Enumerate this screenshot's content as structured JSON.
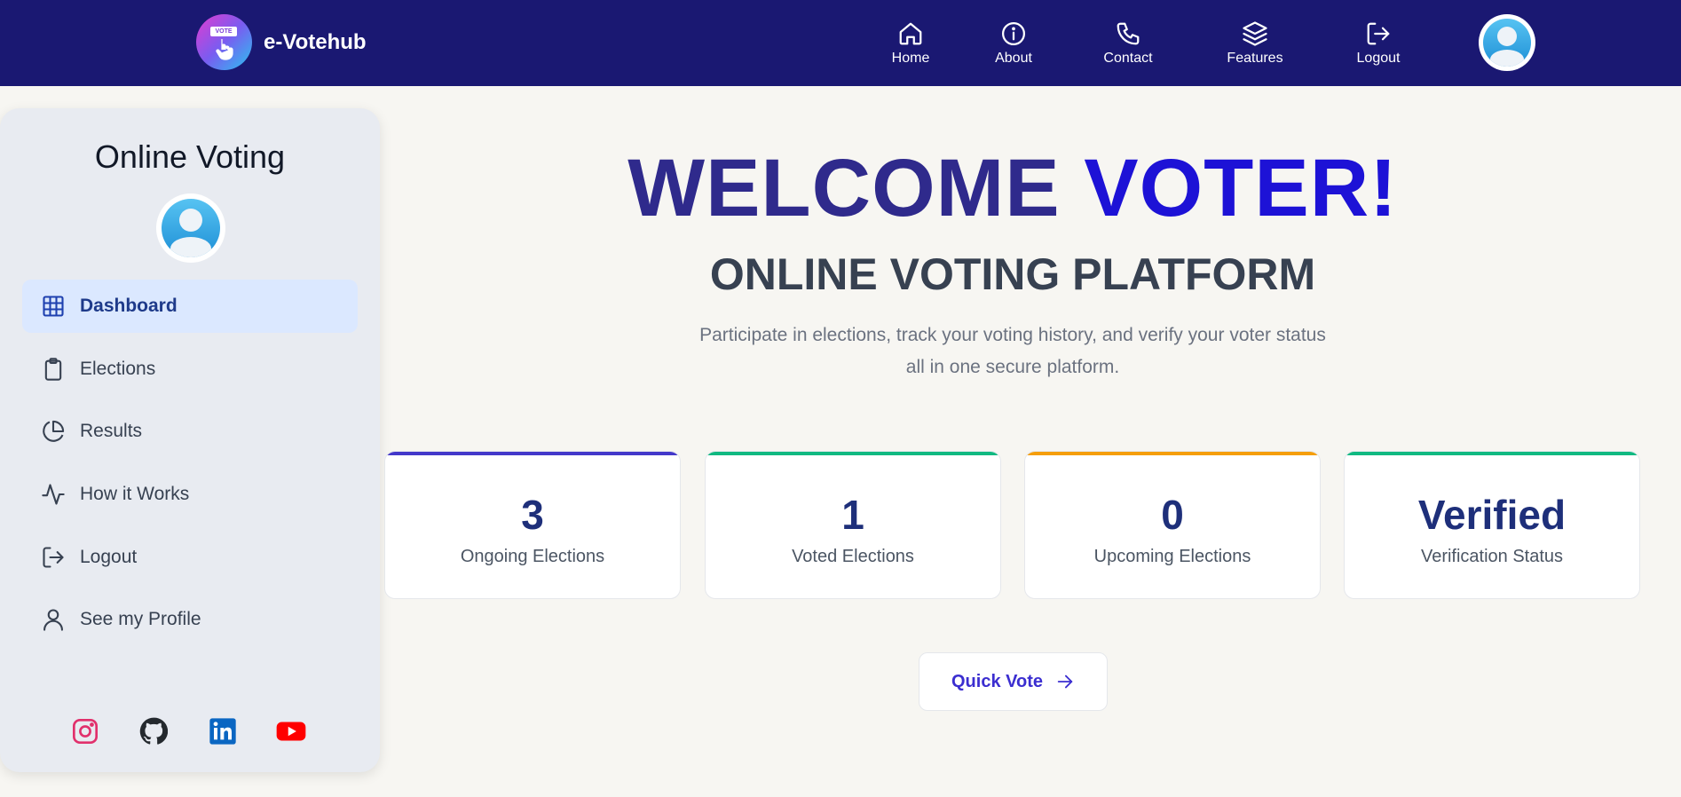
{
  "brand": {
    "name": "e-Votehub",
    "logo_tag": "VOTE"
  },
  "nav": {
    "home": "Home",
    "about": "About",
    "contact": "Contact",
    "features": "Features",
    "logout": "Logout"
  },
  "sidebar": {
    "title": "Online Voting",
    "items": [
      {
        "label": "Dashboard",
        "icon": "grid-icon",
        "active": true
      },
      {
        "label": "Elections",
        "icon": "clipboard-icon"
      },
      {
        "label": "Results",
        "icon": "pie-chart-icon"
      },
      {
        "label": "How it Works",
        "icon": "activity-icon"
      },
      {
        "label": "Logout",
        "icon": "logout-icon"
      },
      {
        "label": "See my Profile",
        "icon": "user-icon"
      }
    ],
    "socials": [
      "instagram-icon",
      "github-icon",
      "linkedin-icon",
      "youtube-icon"
    ]
  },
  "hero": {
    "title_part1": "WELCOME ",
    "title_part2": "VOTER!",
    "subtitle": "ONLINE VOTING PLATFORM",
    "desc_line1": "Participate in elections, track your voting history, and verify your voter status",
    "desc_line2": "all in one secure platform."
  },
  "stats": [
    {
      "value": "3",
      "label": "Ongoing Elections",
      "color": "#4338ca"
    },
    {
      "value": "1",
      "label": "Voted Elections",
      "color": "#10b981"
    },
    {
      "value": "0",
      "label": "Upcoming Elections",
      "color": "#f59e0b"
    },
    {
      "value": "Verified",
      "label": "Verification Status",
      "color": "#10b981"
    }
  ],
  "quick_vote": {
    "label": "Quick Vote"
  },
  "colors": {
    "navbar": "#1a1872",
    "accent": "#1d12d6",
    "hero_title": "#2f2a8c"
  }
}
